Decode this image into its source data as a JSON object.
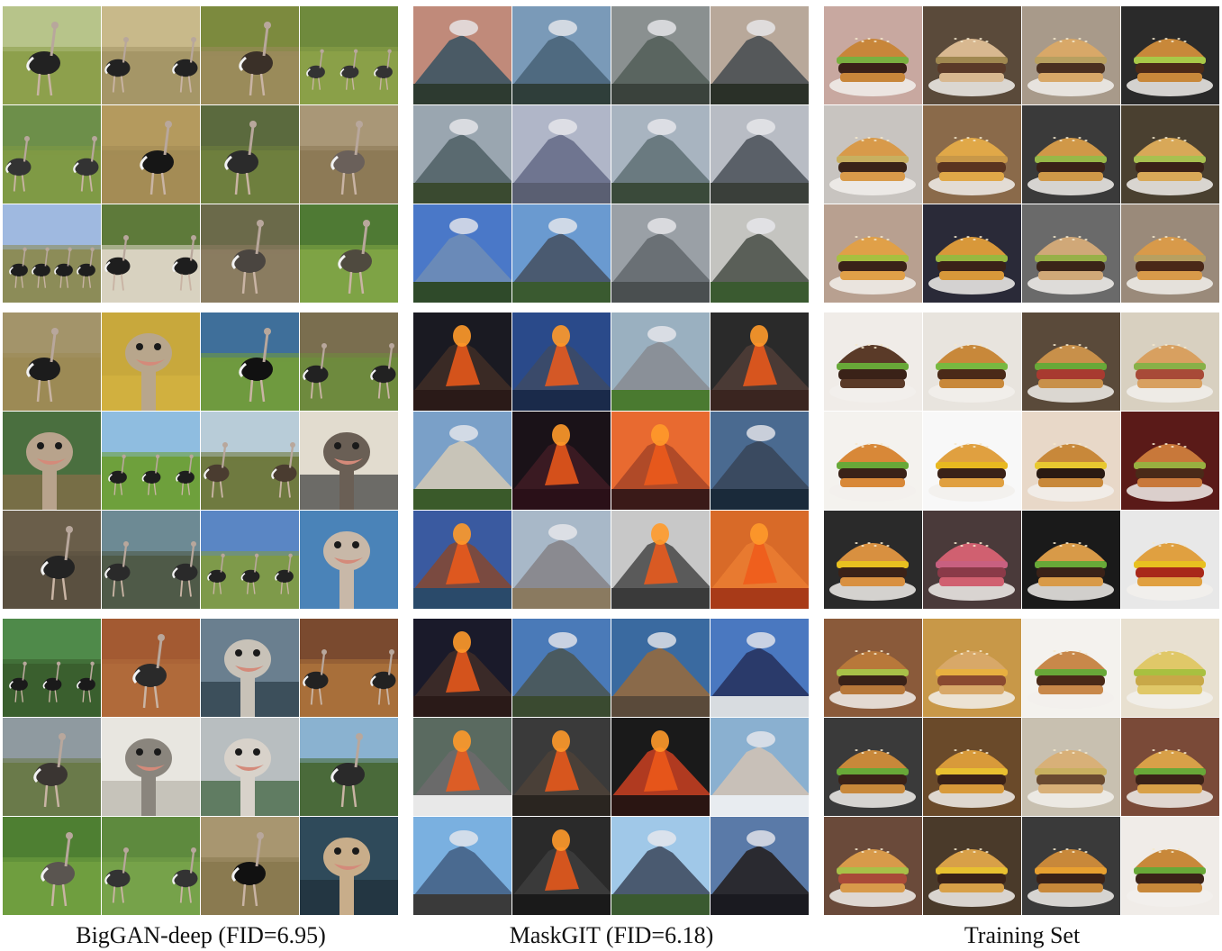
{
  "columns": [
    {
      "caption": "BigGAN-deep (FID=6.95)"
    },
    {
      "caption": "MaskGIT (FID=6.18)"
    },
    {
      "caption": "Training Set"
    }
  ],
  "rows": [
    "ostrich",
    "volcano",
    "cheeseburger"
  ],
  "images": {
    "0": {
      "0": [
        {
          "k": "o",
          "sky": "#b7c48a",
          "gr": "#8da04c",
          "n": 1,
          "c": "#222"
        },
        {
          "k": "o",
          "sky": "#c8b98a",
          "gr": "#a59667",
          "n": 2,
          "c": "#222"
        },
        {
          "k": "o",
          "sky": "#7c8a3e",
          "gr": "#9a8b5a",
          "n": 1,
          "c": "#3a3028"
        },
        {
          "k": "o",
          "sky": "#6f8a3d",
          "gr": "#8aa048",
          "n": 3,
          "c": "#333"
        },
        {
          "k": "o",
          "sky": "#6d8f4a",
          "gr": "#7f9a45",
          "n": 2,
          "c": "#333"
        },
        {
          "k": "o",
          "sky": "#b49a5e",
          "gr": "#a48c55",
          "n": 1,
          "c": "#161616"
        },
        {
          "k": "o",
          "sky": "#5b6a3e",
          "gr": "#6e7f3e",
          "n": 1,
          "c": "#2b2b2b"
        },
        {
          "k": "o",
          "sky": "#a99777",
          "gr": "#8d7a56",
          "n": 1,
          "c": "#6a605a"
        },
        {
          "k": "o",
          "sky": "#9fb9e0",
          "gr": "#8c8c58",
          "n": 4,
          "c": "#1e1e1e"
        },
        {
          "k": "o",
          "sky": "#5e7a3a",
          "gr": "#d8d2c0",
          "n": 2,
          "c": "#1e1e1e"
        },
        {
          "k": "o",
          "sky": "#6b6a4a",
          "gr": "#8a7c60",
          "n": 1,
          "c": "#4a4540"
        },
        {
          "k": "o",
          "sky": "#4f7a34",
          "gr": "#7ea345",
          "n": 1,
          "c": "#4f4a3f"
        }
      ],
      "1": [
        {
          "k": "o",
          "sky": "#a3946a",
          "gr": "#9c8a55",
          "n": 1,
          "c": "#1c1c1c"
        },
        {
          "k": "h",
          "sky": "#c8a83c",
          "gr": "#d4b440",
          "c": "#b8a68c"
        },
        {
          "k": "o",
          "sky": "#3f6f9a",
          "gr": "#6f9a3f",
          "n": 1,
          "c": "#111"
        },
        {
          "k": "o",
          "sky": "#7a6e4f",
          "gr": "#6e8a3e",
          "n": 2,
          "c": "#222"
        },
        {
          "k": "h",
          "sky": "#4a6f3f",
          "gr": "#8a6e4a",
          "c": "#b8a38c"
        },
        {
          "k": "o",
          "sky": "#8fbde0",
          "gr": "#6ea03c",
          "n": 3,
          "c": "#1e1e1e"
        },
        {
          "k": "o",
          "sky": "#b8ccd8",
          "gr": "#6f7a40",
          "n": 2,
          "c": "#4a3c30"
        },
        {
          "k": "h",
          "sky": "#e2dccf",
          "gr": "#3a3a3a",
          "c": "#6a5f55"
        },
        {
          "k": "o",
          "sky": "#6a5e4a",
          "gr": "#5a5040",
          "n": 1,
          "c": "#232323"
        },
        {
          "k": "o",
          "sky": "#6d8a94",
          "gr": "#4f5a48",
          "n": 2,
          "c": "#2a2a2a"
        },
        {
          "k": "o",
          "sky": "#5a86c4",
          "gr": "#7e9a4a",
          "n": 3,
          "c": "#222"
        },
        {
          "k": "h",
          "sky": "#4a83b8",
          "gr": "#4a83b8",
          "c": "#c8b8a8"
        }
      ],
      "2": [
        {
          "k": "o",
          "sky": "#4f8a4a",
          "gr": "#3a5f2e",
          "n": 3,
          "c": "#1a1a1a"
        },
        {
          "k": "o",
          "sky": "#a35a32",
          "gr": "#b06a3a",
          "n": 1,
          "c": "#2a2a2a"
        },
        {
          "k": "h",
          "sky": "#6a7f8f",
          "gr": "#2a3a45",
          "c": "#c8c2b8"
        },
        {
          "k": "o",
          "sky": "#7a4a2f",
          "gr": "#a86f3a",
          "n": 2,
          "c": "#222"
        },
        {
          "k": "o",
          "sky": "#8f9aa0",
          "gr": "#6a7a4a",
          "n": 1,
          "c": "#3a3532"
        },
        {
          "k": "h",
          "sky": "#e8e6e0",
          "gr": "#b8b4aa",
          "c": "#8a857d"
        },
        {
          "k": "h",
          "sky": "#b8bec0",
          "gr": "#3a5f3a",
          "c": "#d8d2ca"
        },
        {
          "k": "o",
          "sky": "#8ab2d0",
          "gr": "#4a6a3a",
          "n": 1,
          "c": "#2a2a2a"
        },
        {
          "k": "o",
          "sky": "#4e7f32",
          "gr": "#6f9e3f",
          "n": 1,
          "c": "#5a5550"
        },
        {
          "k": "o",
          "sky": "#5e8a3e",
          "gr": "#76a24a",
          "n": 2,
          "c": "#333"
        },
        {
          "k": "o",
          "sky": "#a89670",
          "gr": "#8a7a50",
          "n": 1,
          "c": "#111"
        },
        {
          "k": "h",
          "sky": "#2f4a5a",
          "gr": "#1e2e38",
          "c": "#c8ad8a"
        }
      ]
    },
    "1": {
      "0": [
        {
          "k": "v",
          "sky": "#c08a7a",
          "gr": "#2d3a30",
          "m": "#4a5a65",
          "lava": 0
        },
        {
          "k": "v",
          "sky": "#7a9ab8",
          "gr": "#2f3e3a",
          "m": "#4f6a80",
          "lava": 0
        },
        {
          "k": "v",
          "sky": "#8a9090",
          "gr": "#3a423c",
          "m": "#5a6560",
          "lava": 0
        },
        {
          "k": "v",
          "sky": "#b8a89a",
          "gr": "#2a3028",
          "m": "#55585a",
          "lava": 0
        },
        {
          "k": "v",
          "sky": "#9aa6b0",
          "gr": "#3a4a30",
          "m": "#5a6a70",
          "lava": 0
        },
        {
          "k": "v",
          "sky": "#b0b6c8",
          "gr": "#5a5f72",
          "m": "#6f7590",
          "lava": 0
        },
        {
          "k": "v",
          "sky": "#a8b4c0",
          "gr": "#3a4a3a",
          "m": "#6a7a80",
          "lava": 0
        },
        {
          "k": "v",
          "sky": "#b8bcc4",
          "gr": "#3a3f3a",
          "m": "#5a6068",
          "lava": 0
        },
        {
          "k": "v",
          "sky": "#4a78c8",
          "gr": "#2f4a2a",
          "m": "#6a8ab8",
          "lava": 0
        },
        {
          "k": "v",
          "sky": "#6a9ad0",
          "gr": "#3a5a30",
          "m": "#4a5a70",
          "lava": 0
        },
        {
          "k": "v",
          "sky": "#9aa0a6",
          "gr": "#4a4f50",
          "m": "#6a7075",
          "lava": 0
        },
        {
          "k": "v",
          "sky": "#c4c4c0",
          "gr": "#3a5a30",
          "m": "#5a5f58",
          "lava": 0
        }
      ],
      "1": [
        {
          "k": "v",
          "sky": "#1a1a22",
          "gr": "#2a1a18",
          "m": "#3a2a25",
          "lava": 1
        },
        {
          "k": "v",
          "sky": "#2a4a8a",
          "gr": "#1a2a4a",
          "m": "#3a4a6a",
          "lava": 1
        },
        {
          "k": "v",
          "sky": "#9ab0c0",
          "gr": "#4a7a30",
          "m": "#8a9098",
          "lava": 0
        },
        {
          "k": "v",
          "sky": "#2a2a2a",
          "gr": "#3a2520",
          "m": "#4a3a35",
          "lava": 1
        },
        {
          "k": "v",
          "sky": "#7aa0c8",
          "gr": "#3a5a2a",
          "m": "#c8c4b8",
          "lava": 0
        },
        {
          "k": "v",
          "sky": "#1a1218",
          "gr": "#2a1018",
          "m": "#3a1a22",
          "lava": 1
        },
        {
          "k": "v",
          "sky": "#e86a30",
          "gr": "#3a1a18",
          "m": "#b04a28",
          "lava": 1
        },
        {
          "k": "v",
          "sky": "#4a6a90",
          "gr": "#1a2a3a",
          "m": "#3a4a60",
          "lava": 0
        },
        {
          "k": "v",
          "sky": "#3a5aa0",
          "gr": "#2a4a6a",
          "m": "#7a4a40",
          "lava": 1
        },
        {
          "k": "v",
          "sky": "#a8b8c8",
          "gr": "#8a7a60",
          "m": "#8a8a90",
          "lava": 0
        },
        {
          "k": "v",
          "sky": "#c8c8c8",
          "gr": "#3a3a3a",
          "m": "#5a5a5a",
          "lava": 1
        },
        {
          "k": "v",
          "sky": "#d86a28",
          "gr": "#a83a18",
          "m": "#e87a30",
          "lava": 1
        }
      ],
      "2": [
        {
          "k": "v",
          "sky": "#1a1a2a",
          "gr": "#2a1a18",
          "m": "#3a2a28",
          "lava": 1
        },
        {
          "k": "v",
          "sky": "#4a7ab8",
          "gr": "#3a4a30",
          "m": "#4a5a60",
          "lava": 0
        },
        {
          "k": "v",
          "sky": "#3a6aa0",
          "gr": "#5a4a3a",
          "m": "#8a6a4a",
          "lava": 0
        },
        {
          "k": "v",
          "sky": "#4a78c0",
          "gr": "#d8dce0",
          "m": "#2a3a6a",
          "lava": 0
        },
        {
          "k": "v",
          "sky": "#5a6a60",
          "gr": "#e8e8e8",
          "m": "#6a6a6a",
          "lava": 1
        },
        {
          "k": "v",
          "sky": "#3a3a3a",
          "gr": "#2a2520",
          "m": "#4a4038",
          "lava": 1
        },
        {
          "k": "v",
          "sky": "#1a1a1a",
          "gr": "#2a1512",
          "m": "#b03a20",
          "lava": 1
        },
        {
          "k": "v",
          "sky": "#8ab0d0",
          "gr": "#e8ecf0",
          "m": "#c8c0b8",
          "lava": 0
        },
        {
          "k": "v",
          "sky": "#7ab0e0",
          "gr": "#3a3a3a",
          "m": "#4a6a90",
          "lava": 0
        },
        {
          "k": "v",
          "sky": "#2a2a2a",
          "gr": "#1a1a1a",
          "m": "#3a3a3a",
          "lava": 1
        },
        {
          "k": "v",
          "sky": "#a0c8e8",
          "gr": "#3a5a30",
          "m": "#4a5a70",
          "lava": 0
        },
        {
          "k": "v",
          "sky": "#5a7aa8",
          "gr": "#1a1a20",
          "m": "#2a2a30",
          "lava": 0
        }
      ]
    },
    "2": {
      "0": [
        {
          "k": "b",
          "bg": "#c8a8a0",
          "bun": "#c8863a",
          "meat": "#3a2218",
          "let": "#7ab040"
        },
        {
          "k": "b",
          "bg": "#5a4a3a",
          "bun": "#d8b890",
          "meat": "#5a3a28",
          "let": "#a08850"
        },
        {
          "k": "b",
          "bg": "#a89a8a",
          "bun": "#d8a868",
          "meat": "#4a3020",
          "let": "#b8a060"
        },
        {
          "k": "b",
          "bg": "#2a2a2a",
          "bun": "#c8883a",
          "meat": "#4a2a18",
          "let": "#a8c848"
        },
        {
          "k": "b",
          "bg": "#c8c4c0",
          "bun": "#d89a4a",
          "meat": "#3a2418",
          "let": "#c8b060"
        },
        {
          "k": "b",
          "bg": "#8a6a4a",
          "bun": "#e0a848",
          "meat": "#5a3420",
          "let": "#c89848"
        },
        {
          "k": "b",
          "bg": "#3a3a3a",
          "bun": "#d09848",
          "meat": "#3a2218",
          "let": "#98b848"
        },
        {
          "k": "b",
          "bg": "#4a4030",
          "bun": "#d8a858",
          "meat": "#3a2218",
          "let": "#a8c050"
        },
        {
          "k": "b",
          "bg": "#b8a090",
          "bun": "#e0a048",
          "meat": "#3a2218",
          "let": "#a8c040"
        },
        {
          "k": "b",
          "bg": "#2a2a38",
          "bun": "#d8983a",
          "meat": "#3a2218",
          "let": "#98b840"
        },
        {
          "k": "b",
          "bg": "#6a6a6a",
          "bun": "#d0a878",
          "meat": "#3a2418",
          "let": "#98b048"
        },
        {
          "k": "b",
          "bg": "#9a8a7a",
          "bun": "#d89a4a",
          "meat": "#4a2818",
          "let": "#b8a060"
        }
      ],
      "1": [
        {
          "k": "b",
          "bg": "#f0ece8",
          "bun": "#5a3a28",
          "meat": "#3a2218",
          "let": "#68a838"
        },
        {
          "k": "b",
          "bg": "#e8e4de",
          "bun": "#c8883a",
          "meat": "#4a2a18",
          "let": "#78b840"
        },
        {
          "k": "b",
          "bg": "#5a4a3a",
          "bun": "#c8904a",
          "meat": "#a83a30",
          "let": "#68a838"
        },
        {
          "k": "b",
          "bg": "#d8d0c0",
          "bun": "#d8a060",
          "meat": "#a84a38",
          "let": "#88b048"
        },
        {
          "k": "b",
          "bg": "#f4f2ee",
          "bun": "#d88838",
          "meat": "#3a2218",
          "let": "#68a838"
        },
        {
          "k": "b",
          "bg": "#f8f8f8",
          "bun": "#e0a040",
          "meat": "#3a2218",
          "let": "#e8b820"
        },
        {
          "k": "b",
          "bg": "#e8d8c8",
          "bun": "#c8883a",
          "meat": "#2a1a12",
          "let": "#e8c830"
        },
        {
          "k": "b",
          "bg": "#5a1a18",
          "bun": "#c8783a",
          "meat": "#4a2a18",
          "let": "#98b040"
        },
        {
          "k": "b",
          "bg": "#2a2a2a",
          "bun": "#d89040",
          "meat": "#3a2218",
          "let": "#e8c020"
        },
        {
          "k": "b",
          "bg": "#4a3a3a",
          "bun": "#d06070",
          "meat": "#8a3a48",
          "let": "#c86080"
        },
        {
          "k": "b",
          "bg": "#1a1a1a",
          "bun": "#d89a48",
          "meat": "#3a2218",
          "let": "#68a838"
        },
        {
          "k": "b",
          "bg": "#e8e8e8",
          "bun": "#e0a040",
          "meat": "#a8281a",
          "let": "#e8c020"
        }
      ],
      "2": [
        {
          "k": "b",
          "bg": "#8a5a3a",
          "bun": "#b8783a",
          "meat": "#3a2218",
          "let": "#a8c048"
        },
        {
          "k": "b",
          "bg": "#c89848",
          "bun": "#d8a868",
          "meat": "#8a4a30",
          "let": "#e8b040"
        },
        {
          "k": "b",
          "bg": "#f4f2ee",
          "bun": "#c8884a",
          "meat": "#4a2a18",
          "let": "#68a838"
        },
        {
          "k": "b",
          "bg": "#e8e0d0",
          "bun": "#e0c868",
          "meat": "#c8a848",
          "let": "#a8c040"
        },
        {
          "k": "b",
          "bg": "#3a3a3a",
          "bun": "#c8883a",
          "meat": "#3a2218",
          "let": "#68a838"
        },
        {
          "k": "b",
          "bg": "#6a4a2a",
          "bun": "#d89a3a",
          "meat": "#3a2218",
          "let": "#e8c030"
        },
        {
          "k": "b",
          "bg": "#c8c0b0",
          "bun": "#d8b078",
          "meat": "#6a4a30",
          "let": "#c8b060"
        },
        {
          "k": "b",
          "bg": "#7a4a38",
          "bun": "#d8a048",
          "meat": "#3a2218",
          "let": "#68a838"
        },
        {
          "k": "b",
          "bg": "#6a4a3a",
          "bun": "#d89a4a",
          "meat": "#a84a38",
          "let": "#a8c048"
        },
        {
          "k": "b",
          "bg": "#4a3a2a",
          "bun": "#d8a048",
          "meat": "#3a2218",
          "let": "#e8c030"
        },
        {
          "k": "b",
          "bg": "#3a3a3a",
          "bun": "#c8883a",
          "meat": "#3a2218",
          "let": "#e8a030"
        },
        {
          "k": "b",
          "bg": "#f0ece8",
          "bun": "#c8883a",
          "meat": "#3a2218",
          "let": "#68a838"
        }
      ]
    }
  }
}
